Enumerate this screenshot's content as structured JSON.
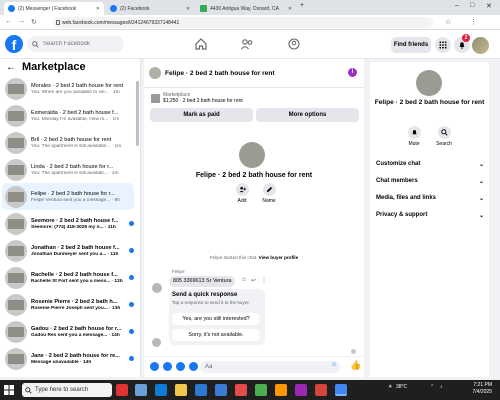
{
  "browser": {
    "tabs": [
      {
        "title": "(2) Messenger | Facebook",
        "active": true
      },
      {
        "title": "(2) Facebook",
        "active": false
      },
      {
        "title": "4430 Antigua Way, Oxnard, CA",
        "active": false
      }
    ],
    "new_tab": "+",
    "url": "web.facebook.com/messages/t/24124679337148441"
  },
  "fb_header": {
    "logo": "f",
    "search_placeholder": "Search Facebook",
    "find_friends": "Find friends",
    "notif_count": "2"
  },
  "sidebar": {
    "title": "Marketplace",
    "conversations": [
      {
        "name": "Morales · 2 bed 2 bath house for rent",
        "snippet": "You: When are you available to vie... · 1m",
        "unread": false,
        "selected": false
      },
      {
        "name": "Esmeralda · 2 bed 2 bath house f...",
        "snippet": "You: Monday I'm available, How m... · 1m",
        "unread": false,
        "selected": false
      },
      {
        "name": "Bril · 2 bed 2 bath house for rent",
        "snippet": "You: The apartment is still available... · 1m",
        "unread": false,
        "selected": false
      },
      {
        "name": "Linda · 2 bed 2 bath house for r...",
        "snippet": "You: The apartment is still availabl... · 1m",
        "unread": false,
        "selected": false
      },
      {
        "name": "Felipe · 2 bed 2 bath house for r...",
        "snippet": "Felipe Ventura sent you a message... · 9h",
        "unread": false,
        "selected": true
      },
      {
        "name": "Seemore · 2 bed 2 bath house f...",
        "snippet": "Seemore: (774) 418-3028 my n... · 11h",
        "unread": true,
        "selected": false
      },
      {
        "name": "Jonathan · 2 bed 2 bath house f...",
        "snippet": "Jonathan Dunmeyer sent you a... · 11h",
        "unread": true,
        "selected": false
      },
      {
        "name": "Rachelle · 2 bed 2 bath house f...",
        "snippet": "Rachelle St Fort sent you a mess... · 12h",
        "unread": true,
        "selected": false
      },
      {
        "name": "Rosenie Pierre · 2 bed 2 bath h...",
        "snippet": "Rosenie Pierre Joseph sent you... · 13h",
        "unread": true,
        "selected": false
      },
      {
        "name": "Gadou · 2 bed 2 bath house for r...",
        "snippet": "Gadou Rex sent you a message... · 14h",
        "unread": true,
        "selected": false
      },
      {
        "name": "Jane · 2 bed 2 bath house for re...",
        "snippet": "Message unavailable · 14h",
        "unread": true,
        "selected": false
      }
    ]
  },
  "chat": {
    "title": "Felipe · 2 bed 2 bath house for rent",
    "listing_label": "Marketplace",
    "listing_price": "$1,250 · 2 bed 2 bath house for rent",
    "mark_paid": "Mark as paid",
    "more_options": "More options",
    "center_name": "Felipe · 2 bed 2 bath house for rent",
    "add_label": "Add",
    "name_label": "Name",
    "started_text": "Felipe started this chat.",
    "view_profile": "View buyer profile",
    "sender": "Felipe",
    "message": "805 3369613 Sr Ventura",
    "quick_title": "Send a quick response",
    "quick_sub": "Tap a response to send it to the buyer.",
    "quick_options": [
      "Yes, are you still interested?",
      "Sorry, it's not available."
    ],
    "composer_placeholder": "Aa"
  },
  "details": {
    "name": "Felipe · 2 bed 2 bath house for rent",
    "mute": "Mute",
    "search": "Search",
    "sections": [
      "Customize chat",
      "Chat members",
      "Media, files and links",
      "Privacy & support"
    ]
  },
  "taskbar": {
    "search_placeholder": "Type here to search",
    "weather": "38°C",
    "time": "7:21 PM",
    "date": "7/4/2025"
  },
  "colors": {
    "fb_blue": "#1877f2",
    "badge_red": "#e41e3f",
    "selected_bg": "#e7f3ff"
  }
}
